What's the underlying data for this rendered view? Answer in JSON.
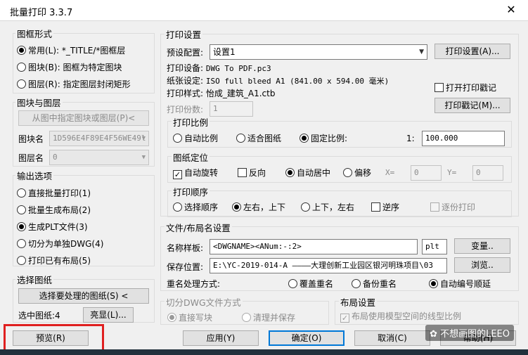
{
  "title": "批量打印 3.3.7",
  "frame_form": {
    "title": "图框形式",
    "options": [
      {
        "label": "常用(L):",
        "value": "*_TITLE/*图框层",
        "selected": true
      },
      {
        "label": "图块(B):",
        "value": "图框为特定图块",
        "selected": false
      },
      {
        "label": "图层(R):",
        "value": "指定图层封闭矩形",
        "selected": false
      }
    ]
  },
  "block_layer": {
    "title": "图块与图层",
    "pick_button": "从图中指定图块或图层(P)<",
    "block_label": "图块名",
    "block_value": "1D596E4F89E4F56WE49l",
    "layer_label": "图层名",
    "layer_value": "0"
  },
  "output": {
    "title": "输出选项",
    "options": [
      {
        "label": "直接批量打印(1)",
        "selected": false
      },
      {
        "label": "批量生成布局(2)",
        "selected": false
      },
      {
        "label": "生成PLT文件(3)",
        "selected": true
      },
      {
        "label": "切分为单独DWG(4)",
        "selected": false
      },
      {
        "label": "打印已有布局(5)",
        "selected": false
      }
    ]
  },
  "select": {
    "title": "选择图纸",
    "button": "选择要处理的图纸(S) <",
    "count_label": "选中图纸:4",
    "highlight_button": "亮显(L)..."
  },
  "print_settings": {
    "title": "打印设置",
    "preset_label": "预设配置:",
    "preset_value": "设置1",
    "settings_button": "打印设置(A)...",
    "device_label": "打印设备:",
    "device_value": "DWG To PDF.pc3",
    "paper_label": "纸张设定:",
    "paper_value": "ISO full bleed A1 (841.00 x 594.00 毫米)",
    "style_label": "打印样式:",
    "style_value": "怡成_建筑_A1.ctb",
    "stamp_checkbox": "打开打印戳记",
    "copies_label": "打印份数:",
    "copies_value": "1",
    "stamp_button": "打印戳记(M)..."
  },
  "scale": {
    "title": "打印比例",
    "options": [
      {
        "label": "自动比例",
        "selected": false
      },
      {
        "label": "适合图纸",
        "selected": false
      },
      {
        "label": "固定比例:",
        "selected": true
      }
    ],
    "ratio_left": "1:",
    "ratio_value": "100.000"
  },
  "position": {
    "title": "图纸定位",
    "auto_rotate": "自动旋转",
    "auto_rotate_checked": true,
    "reverse": "反向",
    "reverse_checked": false,
    "center": "自动居中",
    "offset": "偏移",
    "x_label": "X=",
    "x_value": "0",
    "y_label": "Y=",
    "y_value": "0"
  },
  "order": {
    "title": "打印顺序",
    "options": [
      {
        "label": "选择顺序",
        "selected": false
      },
      {
        "label": "左右，上下",
        "selected": true
      },
      {
        "label": "上下，左右",
        "selected": false
      }
    ],
    "reverse": "逆序",
    "each_copy": "逐份打印"
  },
  "naming": {
    "title": "文件/布局名设置",
    "template_label": "名称样板:",
    "template_value": "<DWGNAME><ANum:-:2>",
    "ext_value": "plt",
    "variable_button": "变量..",
    "location_label": "保存位置:",
    "location_value": "E:\\YC-2019-014-A ————大理创新工业园区银河明珠项目\\03",
    "browse_button": "浏览..",
    "duplicate_label": "重名处理方式:",
    "duplicate_options": [
      {
        "label": "覆盖重名",
        "selected": false
      },
      {
        "label": "备份重名",
        "selected": false
      },
      {
        "label": "自动编号顺延",
        "selected": true
      }
    ]
  },
  "split": {
    "title": "切分DWG文件方式",
    "options": [
      {
        "label": "直接写块",
        "selected": true
      },
      {
        "label": "清理并保存",
        "selected": false
      }
    ]
  },
  "layout": {
    "title": "布局设置",
    "checkbox": "布局使用模型空间的线型比例"
  },
  "footer": {
    "preview": "预览(R)",
    "apply": "应用(Y)",
    "ok": "确定(O)",
    "cancel": "取消(C)",
    "help": "帮助(H)"
  },
  "watermark": "不想画图的LEEO"
}
